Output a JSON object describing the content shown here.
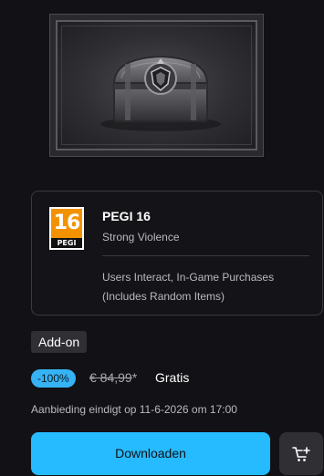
{
  "rating": {
    "badge_age": "16",
    "badge_label": "PEGI",
    "title": "PEGI 16",
    "subtitle": "Strong Violence",
    "description": "Users Interact, In-Game Purchases (Includes Random Items)"
  },
  "product": {
    "tag": "Add-on",
    "discount": "-100%",
    "old_price": "€ 84,99",
    "old_price_suffix": "*",
    "new_price": "Gratis",
    "offer_end": "Aanbieding eindigt op 11-6-2026 om 17:00"
  },
  "actions": {
    "download_label": "Downloaden",
    "cart_icon": "add-to-cart-icon"
  },
  "colors": {
    "accent": "#26bbff",
    "discount_badge": "#36b3f5",
    "background": "#121216",
    "pegi_orange": "#f39200"
  }
}
